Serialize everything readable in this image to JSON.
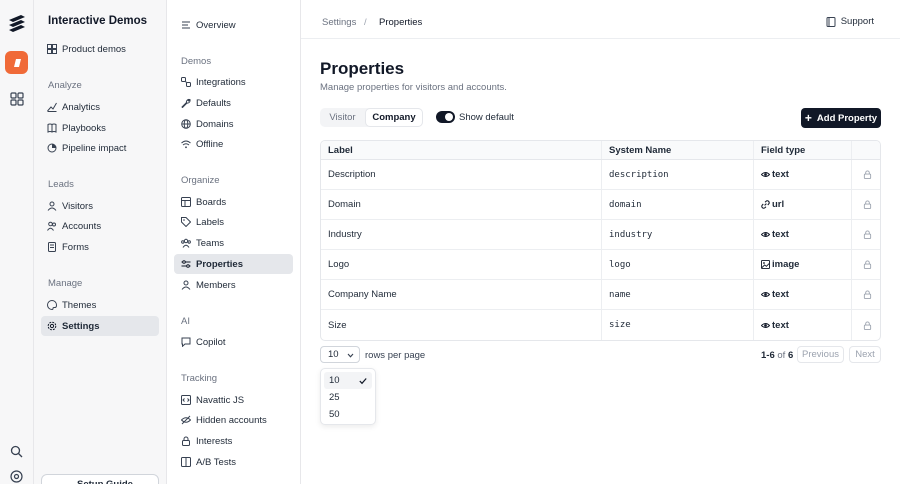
{
  "workspace": {
    "title": "Interactive Demos",
    "top_item": "Product demos",
    "sections": [
      {
        "label": "Analyze",
        "items": [
          "Analytics",
          "Playbooks",
          "Pipeline impact"
        ]
      },
      {
        "label": "Leads",
        "items": [
          "Visitors",
          "Accounts",
          "Forms"
        ]
      },
      {
        "label": "Manage",
        "items": [
          "Themes",
          "Settings"
        ]
      }
    ],
    "active_item": "Settings",
    "setup_guide": "Setup Guide"
  },
  "settings_nav": {
    "overview": "Overview",
    "sections": [
      {
        "label": "Demos",
        "items": [
          "Integrations",
          "Defaults",
          "Domains",
          "Offline"
        ]
      },
      {
        "label": "Organize",
        "items": [
          "Boards",
          "Labels",
          "Teams",
          "Properties",
          "Members"
        ]
      },
      {
        "label": "AI",
        "items": [
          "Copilot"
        ]
      },
      {
        "label": "Tracking",
        "items": [
          "Navattic JS",
          "Hidden accounts",
          "Interests",
          "A/B Tests"
        ]
      }
    ],
    "active_item": "Properties"
  },
  "header": {
    "breadcrumb": [
      "Settings",
      "Properties"
    ],
    "separator": "/",
    "support": "Support"
  },
  "page": {
    "title": "Properties",
    "subtitle": "Manage properties for visitors and accounts.",
    "tabs": [
      "Visitor",
      "Company"
    ],
    "active_tab": "Company",
    "show_default_label": "Show default",
    "show_default_on": true,
    "add_button": "Add Property"
  },
  "table": {
    "columns": [
      "Label",
      "System Name",
      "Field type"
    ],
    "rows": [
      {
        "label": "Description",
        "system": "description",
        "type": "text",
        "icon": "eye-icon"
      },
      {
        "label": "Domain",
        "system": "domain",
        "type": "url",
        "icon": "link-icon"
      },
      {
        "label": "Industry",
        "system": "industry",
        "type": "text",
        "icon": "eye-icon"
      },
      {
        "label": "Logo",
        "system": "logo",
        "type": "image",
        "icon": "image-icon"
      },
      {
        "label": "Company Name",
        "system": "name",
        "type": "text",
        "icon": "eye-icon"
      },
      {
        "label": "Size",
        "system": "size",
        "type": "text",
        "icon": "eye-icon"
      }
    ]
  },
  "pagination": {
    "rows_per_page": "10",
    "rows_per_page_label": "rows per page",
    "range": "1-6",
    "of": "of",
    "total": "6",
    "previous": "Previous",
    "next": "Next",
    "options": [
      "10",
      "25",
      "50"
    ]
  },
  "colors": {
    "accent_dark": "#111827",
    "brand_orange": "#f06a38"
  }
}
